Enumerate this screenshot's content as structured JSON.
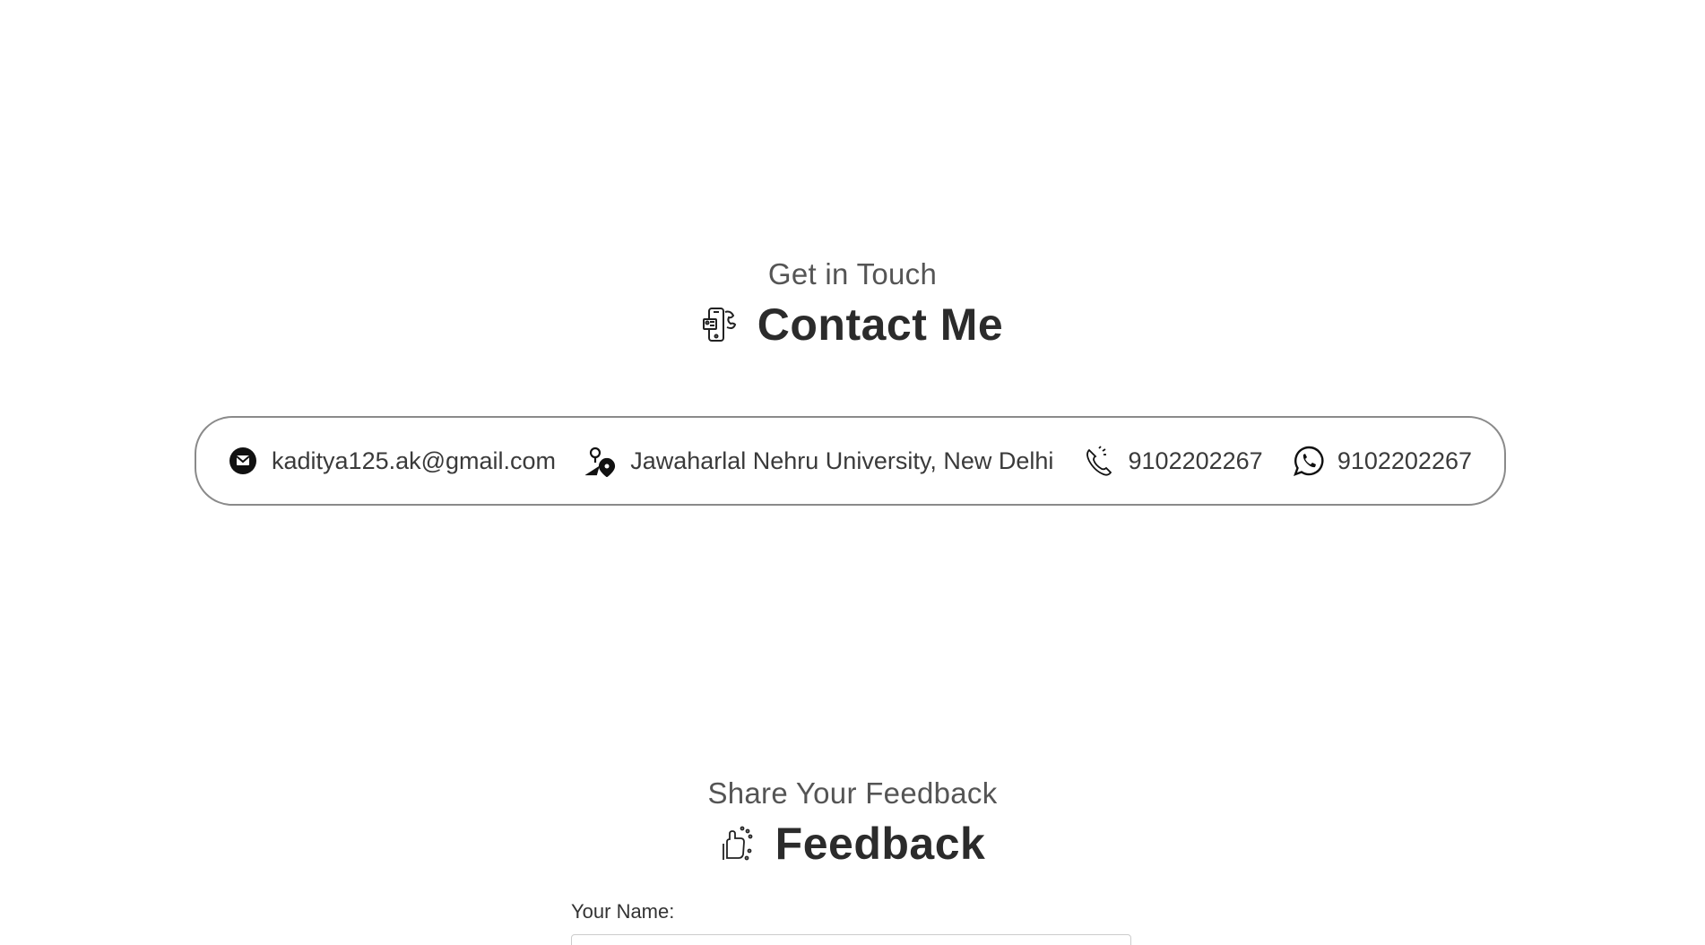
{
  "contact_section": {
    "subtitle": "Get in Touch",
    "title": "Contact Me",
    "title_icon": "phone-contact-icon"
  },
  "contact_items": {
    "email": {
      "icon": "email-icon",
      "text": "kaditya125.ak@gmail.com"
    },
    "location": {
      "icon": "location-icon",
      "text": "Jawaharlal Nehru University, New Delhi"
    },
    "phone": {
      "icon": "phone-icon",
      "text": "9102202267"
    },
    "whatsapp": {
      "icon": "whatsapp-icon",
      "text": "9102202267"
    }
  },
  "feedback_section": {
    "subtitle": "Share Your Feedback",
    "title": "Feedback",
    "title_icon": "feedback-hand-icon"
  },
  "form": {
    "name_label": "Your Name:",
    "name_value": ""
  },
  "colors": {
    "background": "#ffffff",
    "text": "#333333",
    "border": "#8a8a8a"
  }
}
